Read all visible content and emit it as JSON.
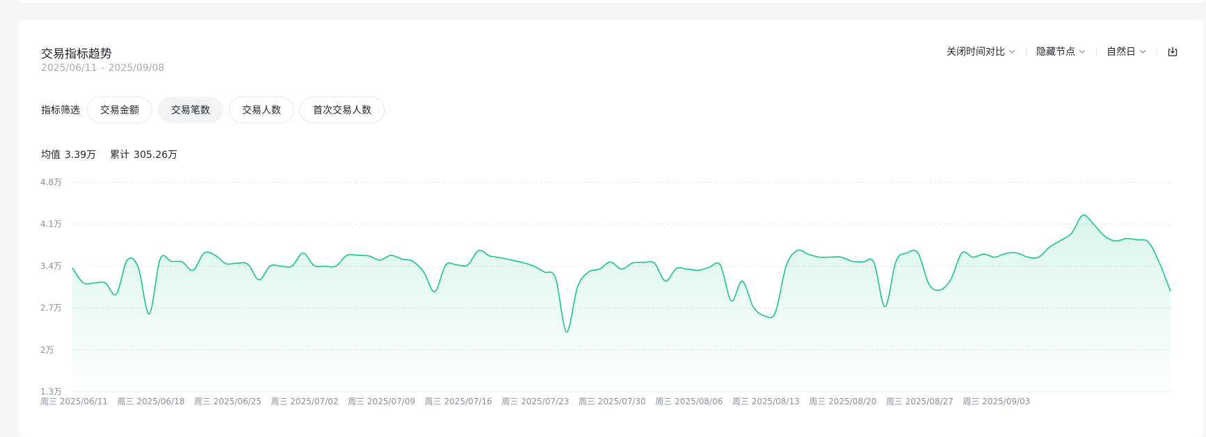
{
  "card": {
    "title": "交易指标趋势",
    "date_range": "2025/06/11 – 2025/09/08"
  },
  "controls": {
    "compare_label": "关闭时间对比",
    "nodes_label": "隐藏节点",
    "period_label": "自然日"
  },
  "filter": {
    "label": "指标筛选",
    "chips": [
      {
        "label": "交易金额",
        "active": false
      },
      {
        "label": "交易笔数",
        "active": true
      },
      {
        "label": "交易人数",
        "active": false
      },
      {
        "label": "首次交易人数",
        "active": false
      }
    ]
  },
  "stats": {
    "avg_label": "均值",
    "avg_value": "3.39万",
    "sum_label": "累计",
    "sum_value": "305.26万"
  },
  "colors": {
    "line": "#19c48a",
    "area": "#19c48a",
    "grid": "#e5e6eb"
  },
  "chart_data": {
    "type": "area",
    "y_tick_labels": [
      "1.3万",
      "2万",
      "2.7万",
      "3.4万",
      "4.1万",
      "4.8万"
    ],
    "y_ticks": [
      1.3,
      2.0,
      2.7,
      3.4,
      4.1,
      4.8
    ],
    "ylim": [
      1.3,
      4.8
    ],
    "x_tick_labels": [
      "周三 2025/06/11",
      "周三 2025/06/18",
      "周三 2025/06/25",
      "周三 2025/07/02",
      "周三 2025/07/09",
      "周三 2025/07/16",
      "周三 2025/07/23",
      "周三 2025/07/30",
      "周三 2025/08/06",
      "周三 2025/08/13",
      "周三 2025/08/20",
      "周三 2025/08/27",
      "周三 2025/09/03"
    ],
    "grid": true,
    "series": [
      {
        "values": [
          3.37,
          3.12,
          3.12,
          3.12,
          2.93,
          3.5,
          3.38,
          2.6,
          3.52,
          3.48,
          3.47,
          3.33,
          3.62,
          3.58,
          3.44,
          3.45,
          3.43,
          3.17,
          3.4,
          3.4,
          3.4,
          3.62,
          3.41,
          3.4,
          3.4,
          3.58,
          3.58,
          3.57,
          3.5,
          3.58,
          3.52,
          3.48,
          3.3,
          2.97,
          3.42,
          3.42,
          3.42,
          3.66,
          3.57,
          3.54,
          3.5,
          3.46,
          3.4,
          3.3,
          3.2,
          2.3,
          3.05,
          3.3,
          3.35,
          3.47,
          3.35,
          3.45,
          3.46,
          3.45,
          3.15,
          3.36,
          3.35,
          3.33,
          3.38,
          3.42,
          2.82,
          3.15,
          2.72,
          2.57,
          2.62,
          3.4,
          3.66,
          3.6,
          3.55,
          3.55,
          3.55,
          3.48,
          3.47,
          3.46,
          2.72,
          3.48,
          3.62,
          3.62,
          3.1,
          3.0,
          3.18,
          3.62,
          3.55,
          3.6,
          3.55,
          3.61,
          3.62,
          3.55,
          3.55,
          3.72,
          3.83,
          3.95,
          4.25,
          4.1,
          3.9,
          3.82,
          3.86,
          3.84,
          3.8,
          3.45,
          2.98
        ]
      }
    ]
  }
}
